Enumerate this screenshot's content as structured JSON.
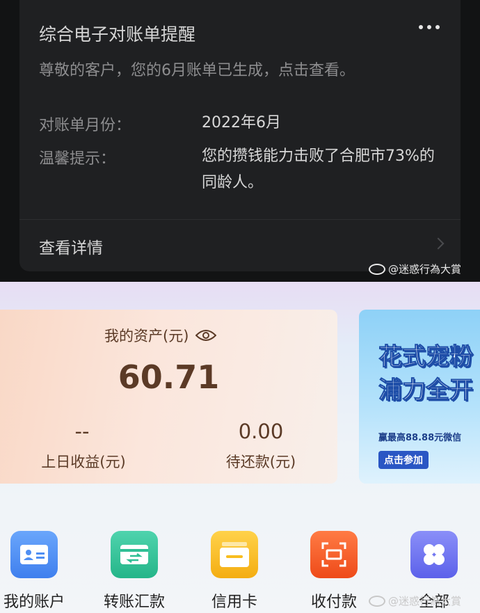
{
  "notification": {
    "title": "综合电子对账单提醒",
    "subtitle": "尊敬的客户，您的6月账单已生成，点击查看。",
    "rows": [
      {
        "label": "对账单月份：",
        "value": "2022年6月"
      },
      {
        "label": "温馨提示：",
        "value": "您的攒钱能力击败了合肥市73%的同龄人。"
      }
    ],
    "details_link": "查看详情"
  },
  "watermark": "@迷惑行為大賞",
  "assets": {
    "title": "我的资产(元)",
    "total": "60.71",
    "yesterday_value": "--",
    "yesterday_label": "上日收益(元)",
    "pending_value": "0.00",
    "pending_label": "待还款(元)"
  },
  "promo": {
    "line1": "花式宠粉",
    "line2": "浦力全开",
    "line3": "赢最高88.88元微信",
    "button": "点击参加"
  },
  "apps": [
    {
      "label": "我的账户",
      "icon": "id-card-icon",
      "color": "#4f8ff3"
    },
    {
      "label": "转账汇款",
      "icon": "transfer-icon",
      "color": "#2fbf95"
    },
    {
      "label": "信用卡",
      "icon": "wallet-icon",
      "color": "#f8bd1f"
    },
    {
      "label": "收付款",
      "icon": "scan-icon",
      "color": "#f4602b"
    },
    {
      "label": "全部",
      "icon": "grid-icon",
      "color": "#6d72f0"
    }
  ],
  "colors": {
    "asset_text": "#5b3a26",
    "dark_card": "#1f2022"
  }
}
